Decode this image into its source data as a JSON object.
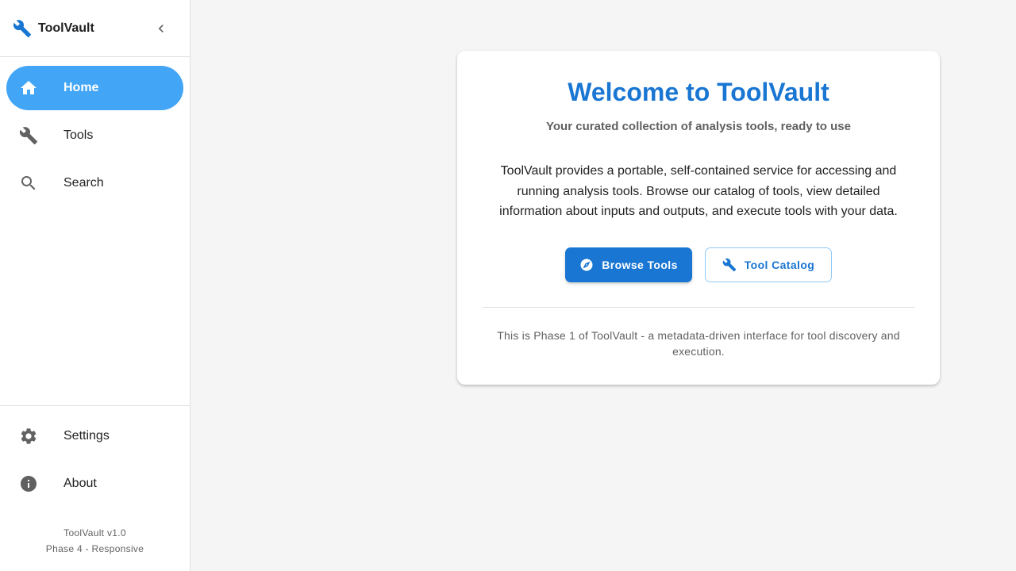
{
  "app": {
    "name": "ToolVault",
    "brand_icon": "wrench-icon",
    "accent_color": "#1976d2",
    "active_nav_color": "#42a5f5"
  },
  "sidebar": {
    "collapse_icon": "chevron-left-icon",
    "items": [
      {
        "label": "Home",
        "icon": "home-icon",
        "active": true
      },
      {
        "label": "Tools",
        "icon": "wrench-icon",
        "active": false
      },
      {
        "label": "Search",
        "icon": "search-icon",
        "active": false
      }
    ],
    "bottom_items": [
      {
        "label": "Settings",
        "icon": "gear-icon"
      },
      {
        "label": "About",
        "icon": "info-icon"
      }
    ],
    "footer": {
      "version": "ToolVault v1.0",
      "phase": "Phase 4 - Responsive"
    }
  },
  "welcome": {
    "title": "Welcome to ToolVault",
    "subtitle": "Your curated collection of analysis tools, ready to use",
    "description": "ToolVault provides a portable, self-contained service for accessing and running analysis tools. Browse our catalog of tools, view detailed information about inputs and outputs, and execute tools with your data.",
    "primary_button": {
      "label": "Browse Tools",
      "icon": "compass-icon"
    },
    "secondary_button": {
      "label": "Tool Catalog",
      "icon": "wrench-icon"
    },
    "note": "This is Phase 1 of ToolVault - a metadata-driven interface for tool discovery and execution."
  }
}
